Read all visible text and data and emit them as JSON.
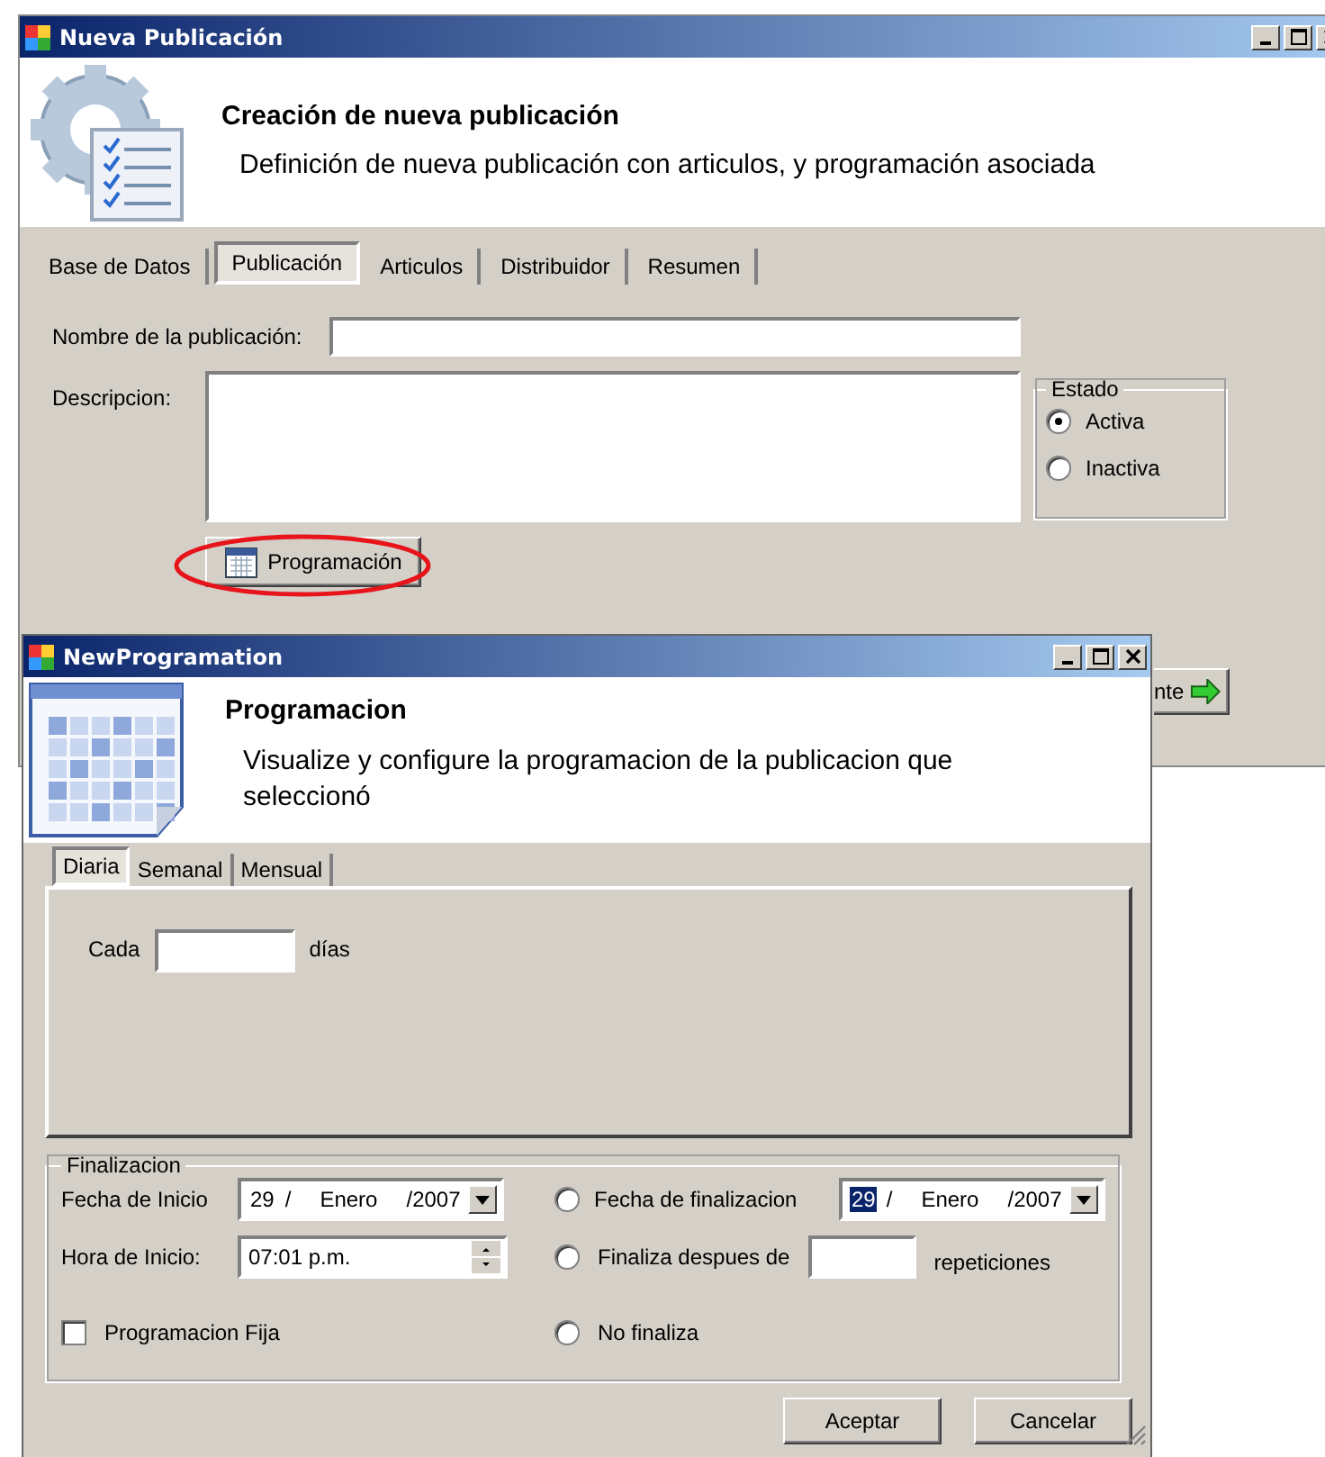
{
  "main_window": {
    "title": "Nueva Publicación",
    "header": {
      "title": "Creación de nueva publicación",
      "subtitle": "Definición de nueva publicación con articulos, y programación asociada"
    },
    "tabs": [
      {
        "label": "Base de Datos",
        "selected": false
      },
      {
        "label": "Publicación",
        "selected": true
      },
      {
        "label": "Articulos",
        "selected": false
      },
      {
        "label": "Distribuidor",
        "selected": false
      },
      {
        "label": "Resumen",
        "selected": false
      }
    ],
    "name_label": "Nombre de la publicación:",
    "description_label": "Descripcion:",
    "estado": {
      "title": "Estado",
      "options": [
        {
          "label": "Activa",
          "selected": true
        },
        {
          "label": "Inactiva",
          "selected": false
        }
      ]
    },
    "programacion_button": {
      "label": "Programación",
      "circled": true
    },
    "next_button": {
      "label": "nte"
    }
  },
  "dialog": {
    "title": "NewProgramation",
    "header": {
      "title": "Programacion",
      "subtitle": "Visualize y configure la programacion de la publicacion que seleccionó"
    },
    "tabs": [
      {
        "label": "Diaria",
        "selected": true
      },
      {
        "label": "Semanal",
        "selected": false
      },
      {
        "label": "Mensual",
        "selected": false
      }
    ],
    "every_label": "Cada",
    "days_label": "días",
    "finalizacion": {
      "title": "Finalizacion",
      "start_date_label": "Fecha de Inicio",
      "start_date": [
        {
          "text": "29",
          "selected": false
        },
        {
          "text": "/",
          "selected": false
        },
        {
          "text": "Enero",
          "selected": false
        },
        {
          "text": "/2007",
          "selected": false
        }
      ],
      "start_time_label": "Hora de Inicio:",
      "start_time": "07:01 p.m.",
      "fixed": {
        "label": "Programacion Fija",
        "checked": false
      },
      "end_date_option": {
        "label": "Fecha de finalizacion",
        "selected": false
      },
      "end_date": [
        {
          "text": "29",
          "selected": true
        },
        {
          "text": "/",
          "selected": false
        },
        {
          "text": "Enero",
          "selected": false
        },
        {
          "text": "/2007",
          "selected": false
        }
      ],
      "after_option": {
        "label": "Finaliza despues de",
        "selected": false
      },
      "repetitions_label": "repeticiones",
      "no_end_option": {
        "label": "No finaliza",
        "selected": false
      }
    },
    "buttons": [
      "Aceptar",
      "Cancelar"
    ]
  }
}
